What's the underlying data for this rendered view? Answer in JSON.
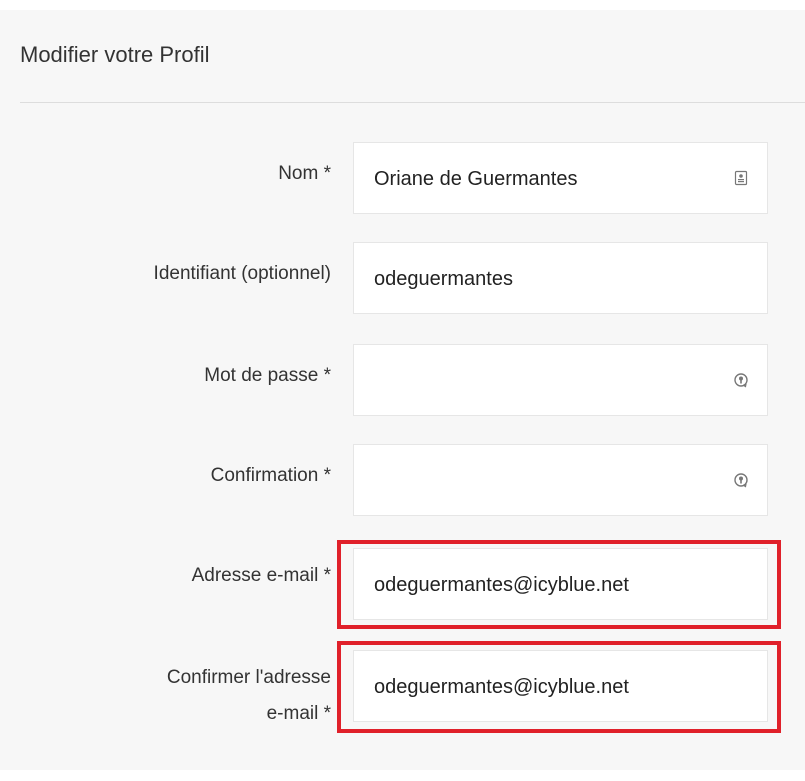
{
  "header": {
    "title": "Modifier votre Profil"
  },
  "form": {
    "name": {
      "label": "Nom *",
      "value": "Oriane de Guermantes",
      "icon": "contact-card-icon"
    },
    "username": {
      "label": "Identifiant (optionnel)",
      "value": "odeguermantes"
    },
    "password": {
      "label": "Mot de passe *",
      "value": "",
      "icon": "password-key-icon"
    },
    "confirm_password": {
      "label": "Confirmation *",
      "value": "",
      "icon": "password-key-icon"
    },
    "email": {
      "label": "Adresse e-mail *",
      "value": "odeguermantes@icyblue.net"
    },
    "confirm_email": {
      "label_line1": "Confirmer l'adresse",
      "label_line2": "e-mail *",
      "value": "odeguermantes@icyblue.net"
    }
  },
  "colors": {
    "highlight": "#e0202a",
    "panel_background": "#f7f7f7",
    "field_background": "#ffffff"
  }
}
